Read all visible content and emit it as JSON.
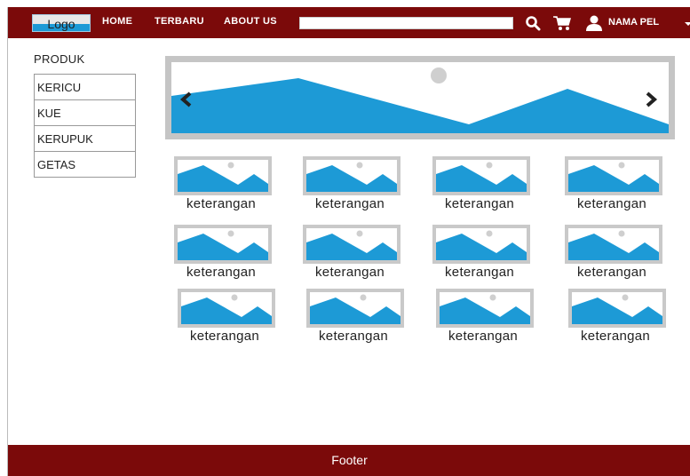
{
  "header": {
    "logo": "Logo",
    "nav": [
      "HOME",
      "TERBARU",
      "ABOUT US"
    ],
    "search": {
      "value": "",
      "placeholder": ""
    },
    "user_name": "NAMA PEL"
  },
  "sidebar": {
    "title": "PRODUK",
    "items": [
      {
        "label": "KERICU"
      },
      {
        "label": "KUE"
      },
      {
        "label": "KERUPUK"
      },
      {
        "label": "GETAS"
      }
    ]
  },
  "products": [
    {
      "caption": "keterangan"
    },
    {
      "caption": "keterangan"
    },
    {
      "caption": "keterangan"
    },
    {
      "caption": "keterangan"
    },
    {
      "caption": "keterangan"
    },
    {
      "caption": "keterangan"
    },
    {
      "caption": "keterangan"
    },
    {
      "caption": "keterangan"
    },
    {
      "caption": "keterangan"
    },
    {
      "caption": "keterangan"
    },
    {
      "caption": "keterangan"
    },
    {
      "caption": "keterangan"
    }
  ],
  "footer": {
    "text": "Footer"
  },
  "colors": {
    "brand": "#7b0a0a",
    "image_fill": "#1d9ad6",
    "frame_gray": "#c5c5c5"
  },
  "icons": [
    "search-icon",
    "cart-icon",
    "user-icon",
    "chevron-down-icon",
    "chevron-left-icon",
    "chevron-right-icon"
  ]
}
